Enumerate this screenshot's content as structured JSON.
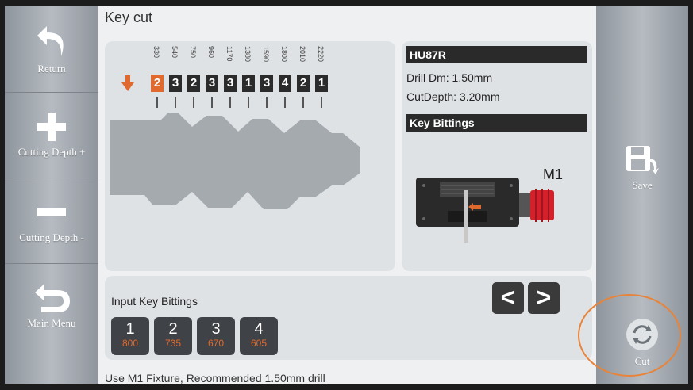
{
  "title": "Key cut",
  "sidebar_left": [
    {
      "label": "Return",
      "icon": "return-arrow-icon"
    },
    {
      "label": "Cutting Depth +",
      "icon": "plus-icon"
    },
    {
      "label": "Cutting Depth -",
      "icon": "minus-icon"
    },
    {
      "label": "Main Menu",
      "icon": "main-menu-arrow-icon"
    }
  ],
  "sidebar_right": [
    {
      "label": "Save",
      "icon": "save-floppy-icon"
    },
    {
      "label": "Cut",
      "icon": "cut-cycle-icon"
    }
  ],
  "bitting": {
    "positions": [
      "330",
      "540",
      "750",
      "960",
      "1170",
      "1380",
      "1590",
      "1800",
      "2010",
      "2220"
    ],
    "cuts": [
      "2",
      "3",
      "2",
      "3",
      "3",
      "1",
      "3",
      "4",
      "2",
      "1"
    ],
    "active_index": 0
  },
  "info": {
    "key_code": "HU87R",
    "drill_dm": "Drill Dm: 1.50mm",
    "cut_depth": "CutDepth: 3.20mm",
    "key_bittings_header": "Key Bittings",
    "fixture_label": "M1"
  },
  "input": {
    "label": "Input Key Bittings",
    "prev": "<",
    "next": ">",
    "keys": [
      {
        "n": "1",
        "v": "800"
      },
      {
        "n": "2",
        "v": "735"
      },
      {
        "n": "3",
        "v": "670"
      },
      {
        "n": "4",
        "v": "605"
      }
    ]
  },
  "status": "Use M1 Fixture, Recommended 1.50mm drill",
  "colors": {
    "accent": "#e0692e",
    "highlight_circle": "#e8843a"
  }
}
